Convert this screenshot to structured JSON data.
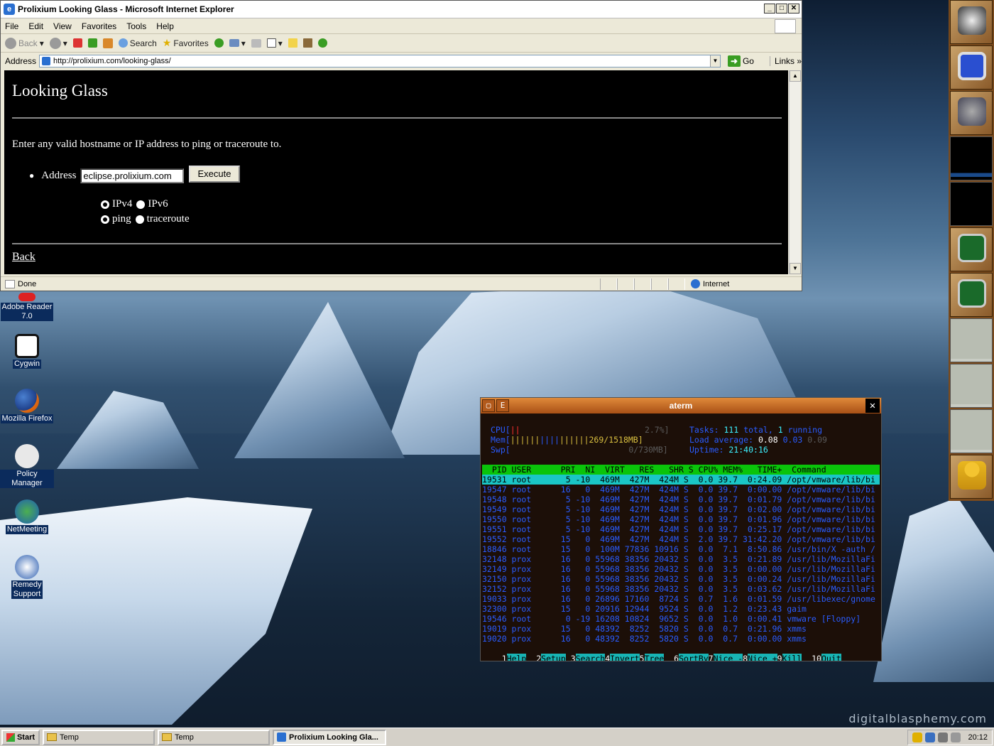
{
  "ie": {
    "title": "Prolixium Looking Glass - Microsoft Internet Explorer",
    "menu": [
      "File",
      "Edit",
      "View",
      "Favorites",
      "Tools",
      "Help"
    ],
    "toolbar": {
      "back": "Back",
      "search": "Search",
      "favorites": "Favorites"
    },
    "address_label": "Address",
    "url": "http://prolixium.com/looking-glass/",
    "go": "Go",
    "links": "Links",
    "status_left": "Done",
    "status_zone": "Internet",
    "page": {
      "heading": "Looking Glass",
      "description": "Enter any valid hostname or IP address to ping or traceroute to.",
      "address_label": "Address",
      "address_value": "eclipse.prolixium.com",
      "execute": "Execute",
      "ipv4": "IPv4",
      "ipv6": "IPv6",
      "ping": "ping",
      "traceroute": "traceroute",
      "back": "Back"
    }
  },
  "desktop_icons": [
    {
      "label1": "Adobe Reader",
      "label2": "7.0"
    },
    {
      "label1": "Cygwin",
      "label2": ""
    },
    {
      "label1": "Mozilla Firefox",
      "label2": ""
    },
    {
      "label1": "Policy Manager",
      "label2": ""
    },
    {
      "label1": "NetMeeting",
      "label2": ""
    },
    {
      "label1": "Remedy",
      "label2": "Support"
    }
  ],
  "watermark": "digitalblasphemy.com",
  "aterm": {
    "title": "aterm",
    "cpu_label": "CPU[",
    "cpu_value": "2.7%]",
    "mem_label": "Mem[",
    "mem_value": "269/1518MB]",
    "swp_label": "Swp[",
    "swp_value": "0/730MB]",
    "tasks_label": "Tasks:",
    "tasks_total": "111",
    "tasks_total_word": "total,",
    "tasks_running": "1",
    "tasks_running_word": "running",
    "load_label": "Load average:",
    "load1": "0.08",
    "load5": "0.03",
    "load15": "0.09",
    "uptime_label": "Uptime:",
    "uptime": "21:40:16",
    "header": "  PID USER      PRI  NI  VIRT   RES   SHR S CPU% MEM%   TIME+  Command",
    "rows": [
      "19531 root       5 -10  469M  427M  424M S  0.0 39.7  0:24.09 /opt/vmware/lib/bi",
      "19547 root      16   0  469M  427M  424M S  0.0 39.7  0:00.00 /opt/vmware/lib/bi",
      "19548 root       5 -10  469M  427M  424M S  0.0 39.7  0:01.79 /opt/vmware/lib/bi",
      "19549 root       5 -10  469M  427M  424M S  0.0 39.7  0:02.00 /opt/vmware/lib/bi",
      "19550 root       5 -10  469M  427M  424M S  0.0 39.7  0:01.96 /opt/vmware/lib/bi",
      "19551 root       5 -10  469M  427M  424M S  0.0 39.7  0:25.17 /opt/vmware/lib/bi",
      "19552 root      15   0  469M  427M  424M S  2.0 39.7 31:42.20 /opt/vmware/lib/bi",
      "18846 root      15   0  100M 77836 10916 S  0.0  7.1  8:50.86 /usr/bin/X -auth /",
      "32148 prox      16   0 55968 38356 20432 S  0.0  3.5  0:21.89 /usr/lib/MozillaFi",
      "32149 prox      16   0 55968 38356 20432 S  0.0  3.5  0:00.00 /usr/lib/MozillaFi",
      "32150 prox      16   0 55968 38356 20432 S  0.0  3.5  0:00.24 /usr/lib/MozillaFi",
      "32152 prox      16   0 55968 38356 20432 S  0.0  3.5  0:03.62 /usr/lib/MozillaFi",
      "19033 prox      16   0 26896 17160  8724 S  0.7  1.6  0:01.59 /usr/libexec/gnome",
      "32300 prox      15   0 20916 12944  9524 S  0.0  1.2  0:23.43 gaim",
      "19546 root       0 -19 16208 10824  9652 S  0.0  1.0  0:00.41 vmware [Floppy]",
      "19019 prox      15   0 48392  8252  5820 S  0.0  0.7  0:21.96 xmms",
      "19020 prox      16   0 48392  8252  5820 S  0.0  0.7  0:00.00 xmms"
    ],
    "fkeys": [
      {
        "k": "1",
        "v": "Help"
      },
      {
        "k": "2",
        "v": "Setup"
      },
      {
        "k": "3",
        "v": "Search"
      },
      {
        "k": "4",
        "v": "Invert"
      },
      {
        "k": "5",
        "v": "Tree"
      },
      {
        "k": "6",
        "v": "SortBy"
      },
      {
        "k": "7",
        "v": "Nice -"
      },
      {
        "k": "8",
        "v": "Nice +"
      },
      {
        "k": "9",
        "v": "Kill"
      },
      {
        "k": "10",
        "v": "Quit"
      }
    ]
  },
  "taskbar": {
    "start": "Start",
    "tasks": [
      "Temp",
      "Temp",
      "Prolixium Looking Gla..."
    ],
    "clock": "20:12"
  }
}
